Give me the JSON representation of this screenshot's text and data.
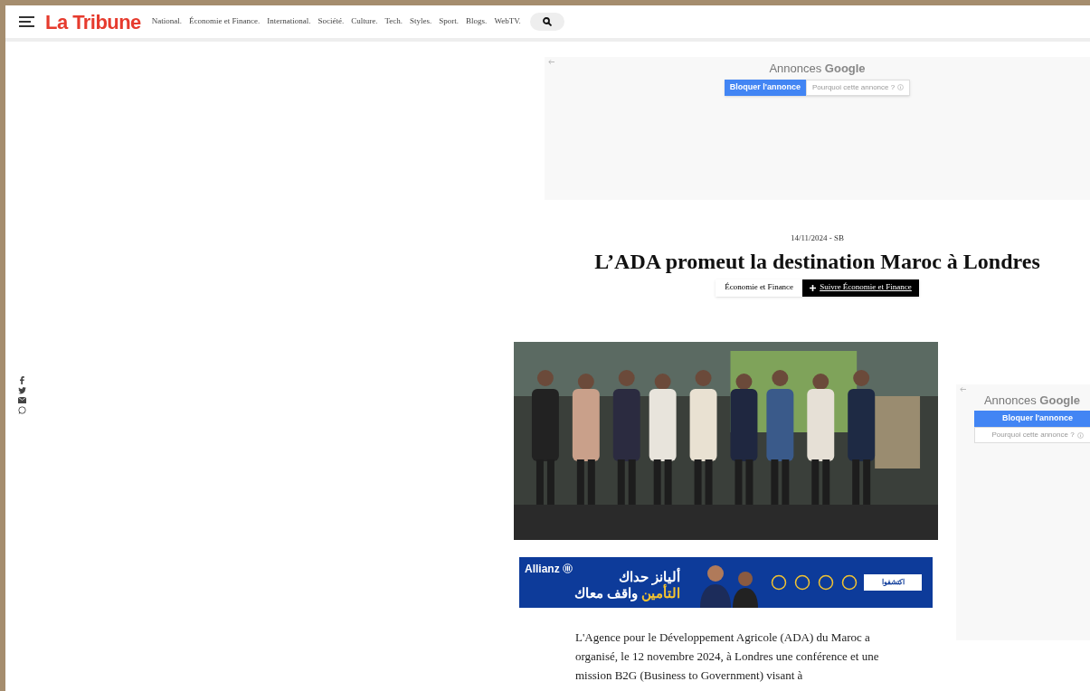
{
  "header": {
    "logo": "La Tribune",
    "nav": [
      {
        "label": "National."
      },
      {
        "label": "Économie et Finance."
      },
      {
        "label": "International."
      },
      {
        "label": "Société."
      },
      {
        "label": "Culture."
      },
      {
        "label": "Tech."
      },
      {
        "label": "Styles."
      },
      {
        "label": "Sport."
      },
      {
        "label": "Blogs."
      },
      {
        "label": "WebTV."
      }
    ]
  },
  "top_ad": {
    "title_prefix": "Annonces",
    "title_brand": "Google",
    "block_button": "Bloquer l'annonce",
    "why_button": "Pourquoi cette annonce ?"
  },
  "article": {
    "meta": "14/11/2024 - SB",
    "title": "L’ADA promeut la destination Maroc à Londres",
    "category": "Économie et Finance",
    "follow": "Suivre Économie et Finance",
    "body": "L'Agence pour le Développement Agricole (ADA) du Maroc a organisé, le 12 novembre 2024, à Londres une conférence et une mission B2G (Business to Government) visant à"
  },
  "banner_ad": {
    "brand": "Allianz",
    "line1": "أليانز حداك",
    "line2_highlight": "التأمين",
    "line2_rest": "واقف معاك",
    "cta": "اكتشفوا"
  },
  "side_ad": {
    "title_prefix": "Annonces",
    "title_brand": "Google",
    "block_button": "Bloquer l'annonce",
    "why_button": "Pourquoi cette annonce ?"
  }
}
